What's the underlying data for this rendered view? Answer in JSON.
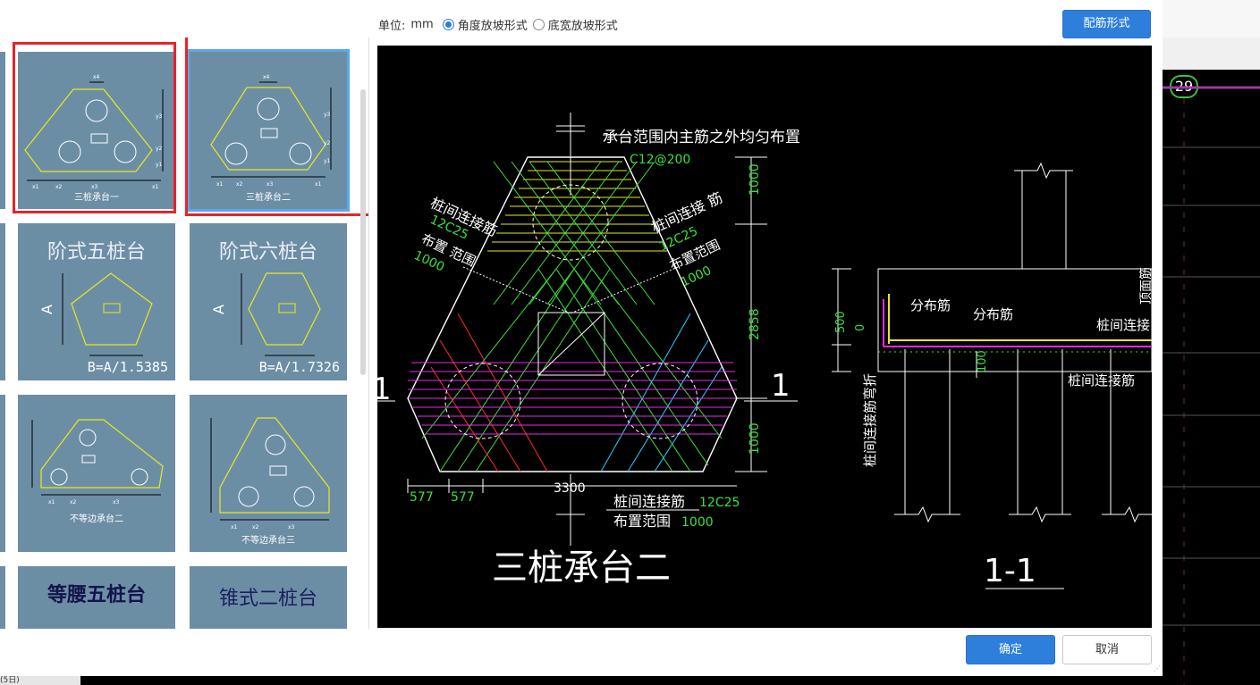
{
  "toolbar": {
    "unit_label": "单位:",
    "unit_value": "mm",
    "slope_options": [
      {
        "label": "角度放坡形式",
        "selected": true
      },
      {
        "label": "底宽放坡形式",
        "selected": false
      }
    ],
    "reinforce_button": "配筋形式"
  },
  "gallery": {
    "items": [
      {
        "caption": "三桩承台一",
        "selected": false,
        "highlighted": true
      },
      {
        "caption": "三桩承台二",
        "selected": true,
        "highlighted": true
      },
      {
        "title": "阶式五桩台",
        "formula": "B=A/1.5385",
        "dim": "A"
      },
      {
        "title": "阶式六桩台",
        "formula": "B=A/1.7326",
        "dim": "A"
      },
      {
        "caption": "不等边承台二"
      },
      {
        "caption": "不等边承台三"
      },
      {
        "title": "等腰五桩台"
      },
      {
        "title": "锥式二桩台"
      }
    ],
    "small_labels": {
      "x1": "x1",
      "x2": "x2",
      "x3": "x3",
      "x4": "x4",
      "x5": "x5",
      "y1": "y1",
      "y2": "y2",
      "y3": "y3",
      "y4": "y4"
    }
  },
  "preview": {
    "title": "三桩承台二",
    "section_title": "1-1",
    "section_mark": "1",
    "note_top": "承台范围内主筋之外均匀布置",
    "note_top_spec": "C12@200",
    "left_label": "桩间连接筋",
    "left_spec": "12C25",
    "left_range_label": "布置 范围",
    "left_range_value": "1000",
    "right_label": "桩间连接 筋",
    "right_spec": "12C25",
    "right_range_label": "布置范围",
    "right_range_value": "1000",
    "bottom_label": "桩间连接筋",
    "bottom_spec": "12C25",
    "bottom_range_label": "布置范围",
    "bottom_range_value": "1000",
    "dims": {
      "d1": "1000",
      "d2": "2858",
      "d3": "1000",
      "w1": "577",
      "w2": "577",
      "w_total": "3300"
    },
    "section": {
      "dist1": "分布筋",
      "dist2": "分布筋",
      "conn": "桩间连接",
      "conn2": "桩间连接筋",
      "bend": "桩间连接筋弯折",
      "h1": "500",
      "h2": "0",
      "h3": "100",
      "top_face": "顶面筋"
    }
  },
  "footer": {
    "ok": "确定",
    "cancel": "取消"
  },
  "background": {
    "badge": "29",
    "strip_label": "(5日)"
  },
  "colors": {
    "primary": "#2e7fdc",
    "highlight": "#e8232a",
    "tile": "#6c8ea5",
    "cad_bg": "#000000"
  }
}
